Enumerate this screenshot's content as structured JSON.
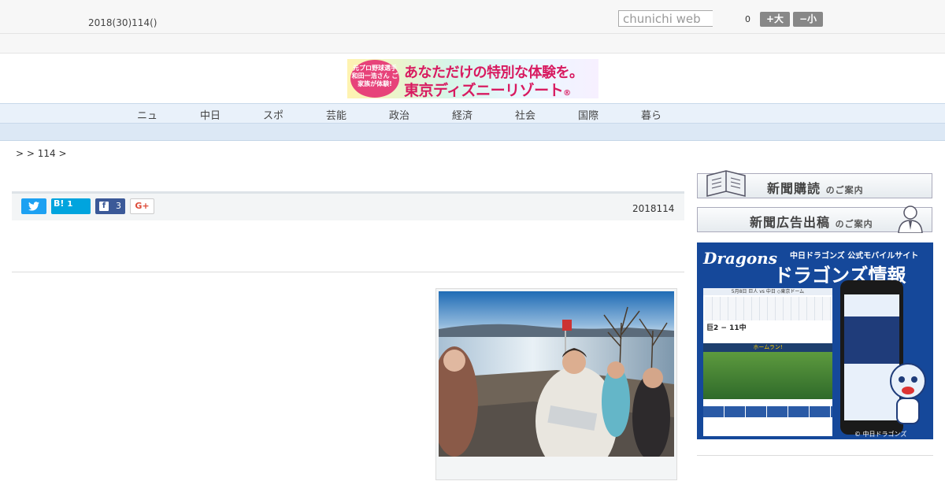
{
  "header": {
    "date": "2018(30)114()",
    "search_placeholder": "chunichi web",
    "count": "0",
    "font_larger": "+大",
    "font_smaller": "−小"
  },
  "banner": {
    "badge": "元プロ野球選手 和田一浩さん ご家族が体験!",
    "line1": "あなただけの特別な体験を。",
    "line2": "東京ディズニーリゾート",
    "mark": "®"
  },
  "nav": {
    "items": [
      "ニュ",
      "中日",
      "スポ",
      "芸能",
      "政治",
      "経済",
      "社会",
      "国際",
      "暮ら"
    ]
  },
  "breadcrumb": "> > 114 >",
  "article": {
    "share": {
      "twitter_icon": "twitter-icon",
      "hatena_label": "B!",
      "hatena_count": "1",
      "facebook_count": "3",
      "gplus_label": "G+"
    },
    "date": "2018114"
  },
  "sidebar": {
    "subscribe": {
      "main": "新聞購読",
      "sub": "のご案内"
    },
    "advertise": {
      "main": "新聞広告出稿",
      "sub": "のご案内"
    },
    "dragons": {
      "logo": "Dragons",
      "headline_small": "中日ドラゴンズ 公式モバイルサイト",
      "headline_big": "ドラゴンズ情報",
      "game": "5月8日 巨人 vs 中日 ◇東京ドーム",
      "score": "巨2 − 11中",
      "homerun": "ホームラン!",
      "copyright": "© 中日ドラゴンズ"
    }
  },
  "colors": {
    "nav_bg": "#e9f1fa",
    "twitter": "#1da1f2",
    "hatena": "#00a4de",
    "facebook": "#3b5998",
    "dragons_blue": "#15489a"
  }
}
